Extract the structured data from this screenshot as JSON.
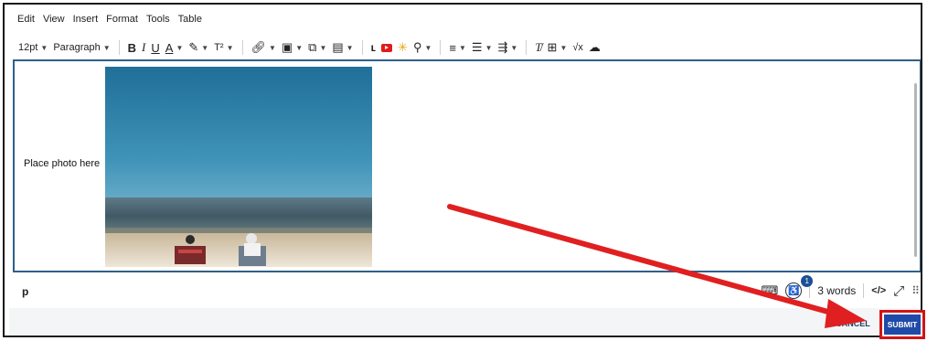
{
  "menu": {
    "items": [
      "Edit",
      "View",
      "Insert",
      "Format",
      "Tools",
      "Table"
    ]
  },
  "toolbar": {
    "font_size": "12pt",
    "block_format": "Paragraph",
    "bold": "B",
    "italic": "I",
    "underline": "U",
    "text_color": "A",
    "superscript": "T²",
    "math": "√x"
  },
  "editor": {
    "placeholder_text": "Place photo here"
  },
  "statusbar": {
    "path": "p",
    "accessibility_count": "1",
    "word_count": "3 words",
    "html_code": "</>"
  },
  "actions": {
    "cancel_label": "CANCEL",
    "submit_label": "SUBMIT"
  },
  "colors": {
    "accent": "#1f4aa8",
    "annotation": "#d21414",
    "editor_border": "#2f5f8a"
  }
}
